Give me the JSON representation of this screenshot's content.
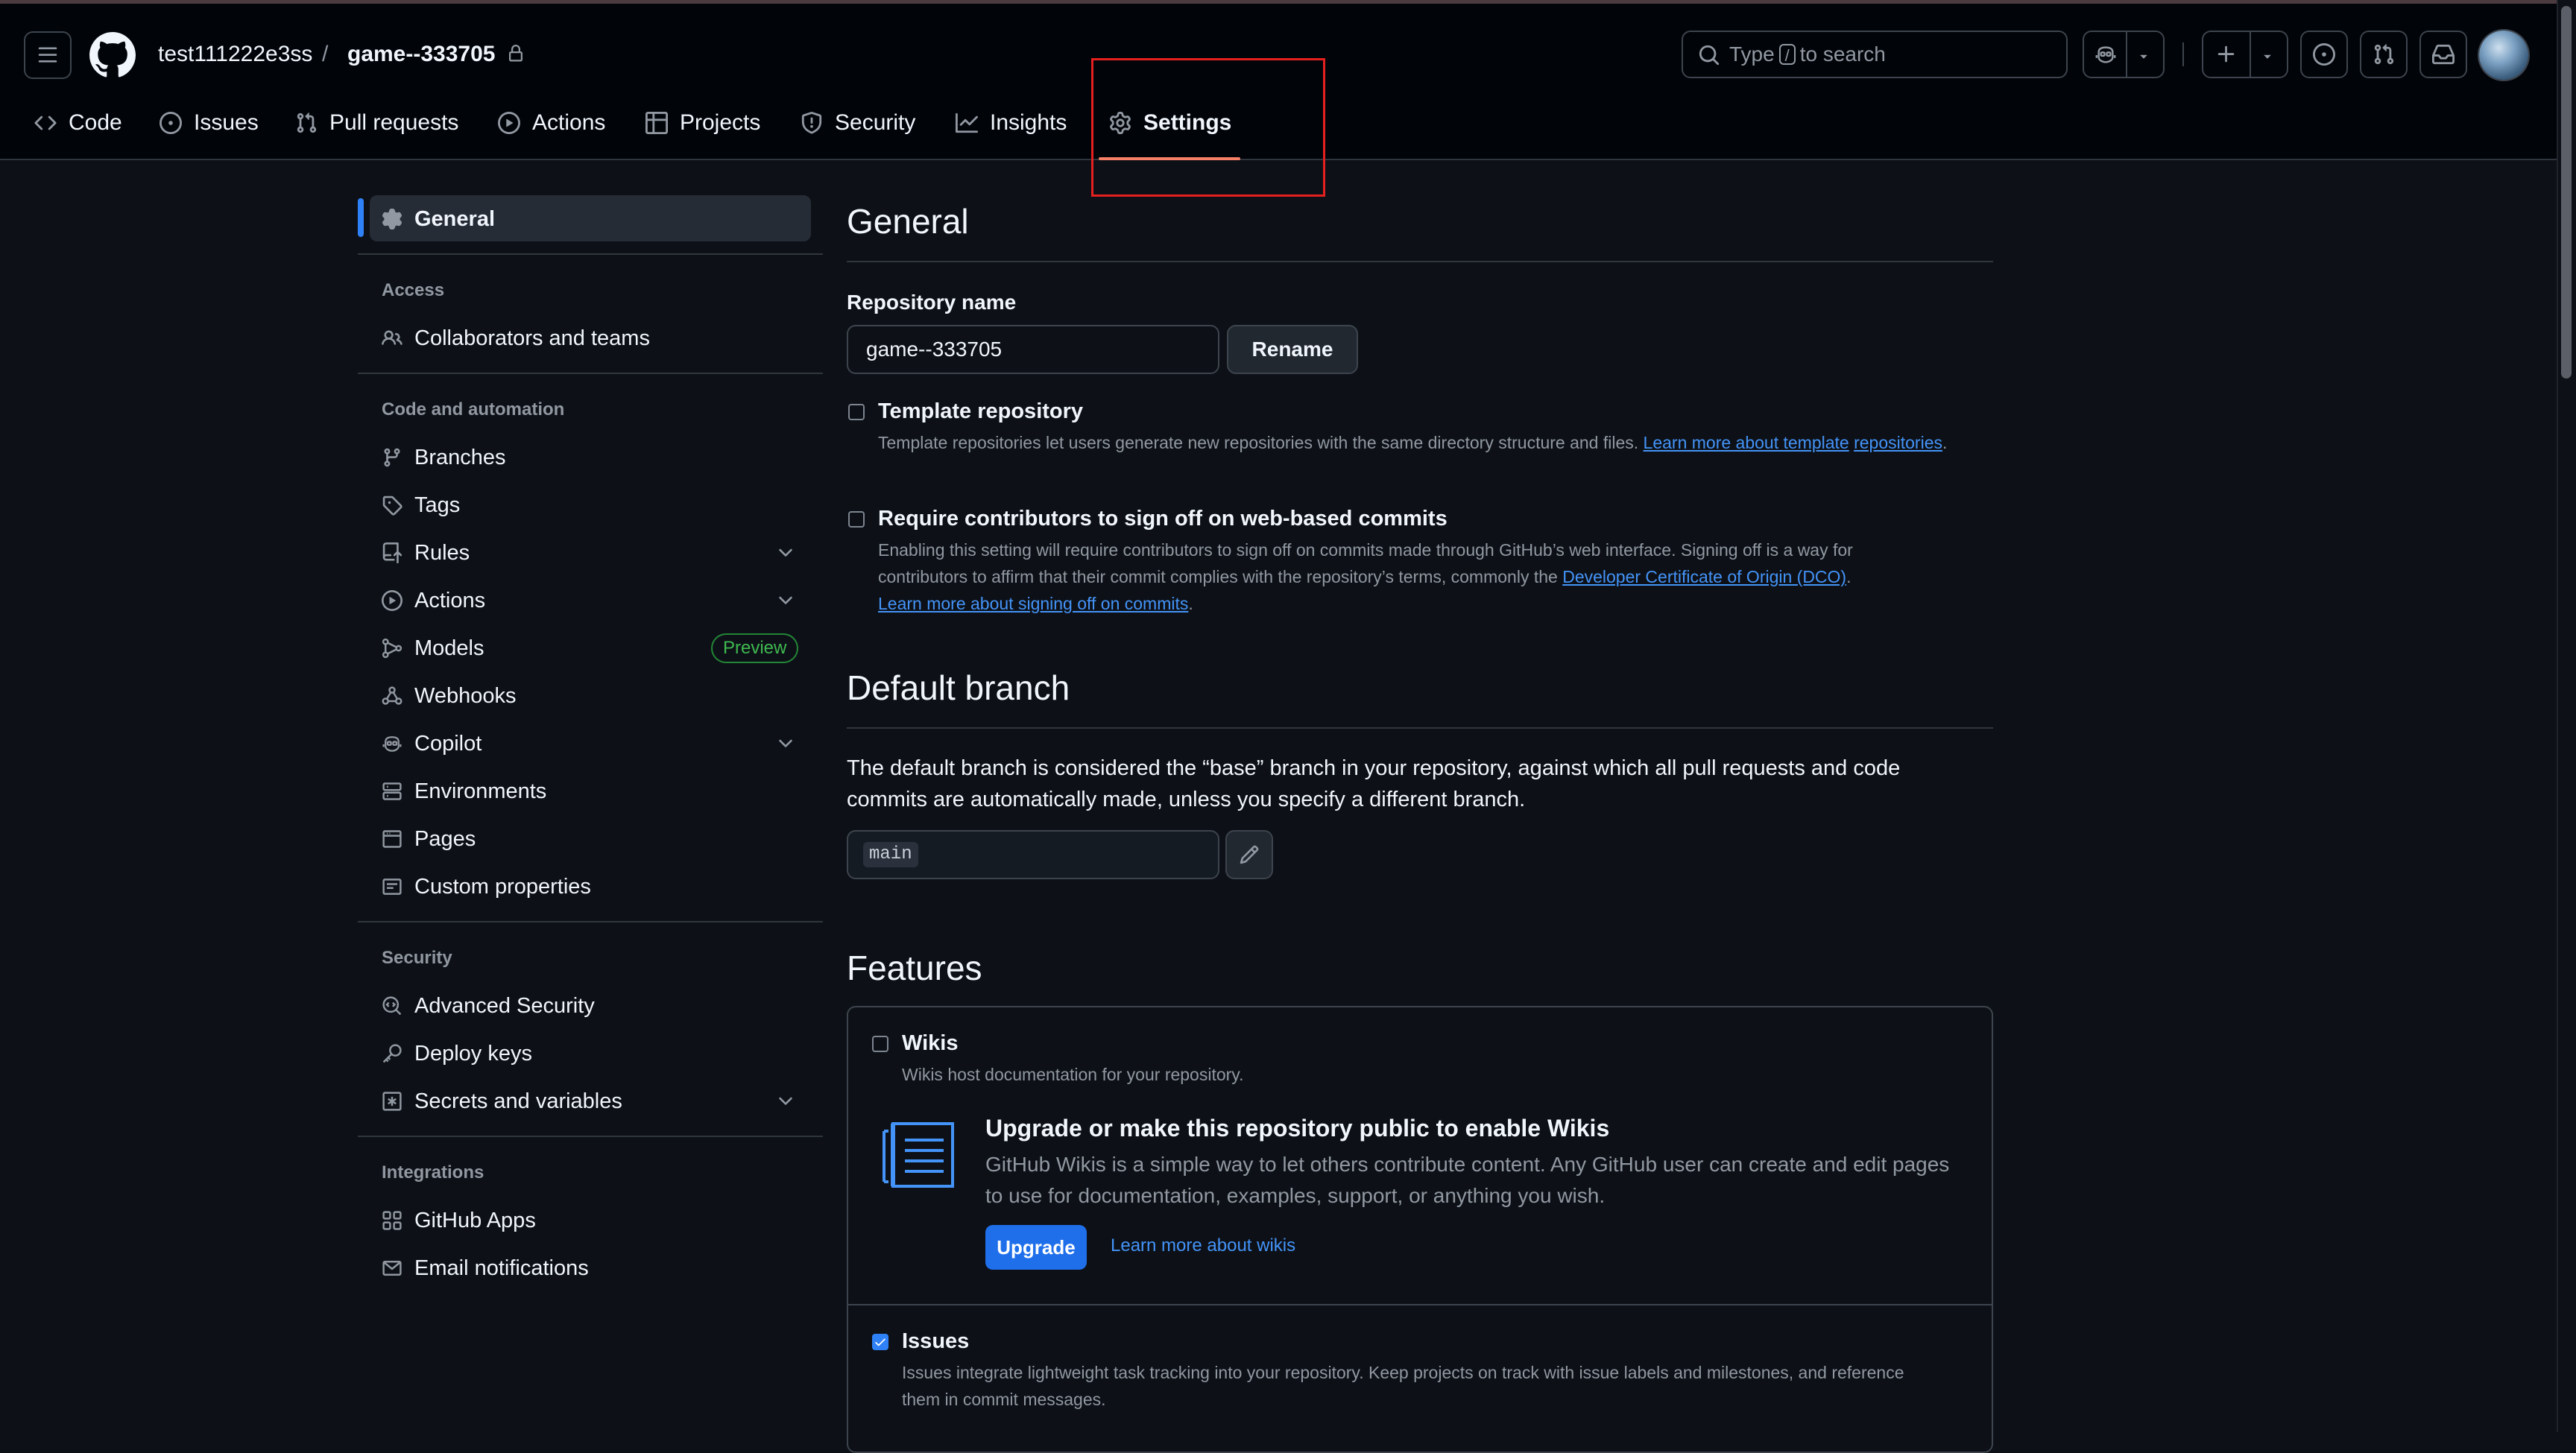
{
  "header": {
    "owner": "test111222e3ss",
    "separator": "/",
    "repo": "game--333705",
    "search_prefix": "Type",
    "search_key": "/",
    "search_suffix": "to search"
  },
  "repo_tabs": [
    {
      "label": "Code",
      "icon": "code-icon"
    },
    {
      "label": "Issues",
      "icon": "issue-opened-icon"
    },
    {
      "label": "Pull requests",
      "icon": "pull-request-icon"
    },
    {
      "label": "Actions",
      "icon": "play-icon"
    },
    {
      "label": "Projects",
      "icon": "table-icon"
    },
    {
      "label": "Security",
      "icon": "shield-icon"
    },
    {
      "label": "Insights",
      "icon": "graph-icon"
    },
    {
      "label": "Settings",
      "icon": "gear-icon",
      "selected": true
    }
  ],
  "sidebar": {
    "general": "General",
    "sections": {
      "access": "Access",
      "code_automation": "Code and automation",
      "security": "Security",
      "integrations": "Integrations"
    },
    "items": {
      "collaborators": "Collaborators and teams",
      "branches": "Branches",
      "tags": "Tags",
      "rules": "Rules",
      "actions": "Actions",
      "models": "Models",
      "models_badge": "Preview",
      "webhooks": "Webhooks",
      "copilot": "Copilot",
      "environments": "Environments",
      "pages": "Pages",
      "custom_properties": "Custom properties",
      "advanced_security": "Advanced Security",
      "deploy_keys": "Deploy keys",
      "secrets": "Secrets and variables",
      "github_apps": "GitHub Apps",
      "email_notifications": "Email notifications"
    }
  },
  "general": {
    "heading": "General",
    "repo_name_label": "Repository name",
    "repo_name_value": "game--333705",
    "rename_label": "Rename",
    "template": {
      "title": "Template repository",
      "checked": false,
      "desc": "Template repositories let users generate new repositories with the same directory structure and files.",
      "link1": "Learn more about template",
      "link2": "repositories",
      "end": "."
    },
    "signoff": {
      "title": "Require contributors to sign off on web-based commits",
      "checked": false,
      "desc1": "Enabling this setting will require contributors to sign off on commits made through GitHub’s web interface. Signing off is a way for",
      "desc2": "contributors to affirm that their commit complies with the repository’s terms, commonly the",
      "link_dco": "Developer Certificate of Origin (DCO)",
      "link_learn": "Learn more about signing off on commits",
      "end": "."
    }
  },
  "default_branch": {
    "heading": "Default branch",
    "desc": "The default branch is considered the “base” branch in your repository, against which all pull requests and code commits are automatically made, unless you specify a different branch.",
    "branch": "main"
  },
  "features": {
    "heading": "Features",
    "wikis": {
      "title": "Wikis",
      "checked": false,
      "desc": "Wikis host documentation for your repository.",
      "upgrade_title": "Upgrade or make this repository public to enable Wikis",
      "upgrade_desc": "GitHub Wikis is a simple way to let others contribute content. Any GitHub user can create and edit pages to use for documentation, examples, support, or anything you wish.",
      "upgrade_button": "Upgrade",
      "learn_more": "Learn more about wikis"
    },
    "issues": {
      "title": "Issues",
      "checked": true,
      "desc": "Issues integrate lightweight task tracking into your repository. Keep projects on track with issue labels and milestones, and reference them in commit messages."
    }
  },
  "colors": {
    "background": "#0d1117",
    "header_bg": "#010409",
    "accent_link": "#4493f8",
    "selected_tab_underline": "#f78166",
    "highlight_box": "#e5201f",
    "upgrade_button": "#1f6feb",
    "preview_badge": "#3fb950"
  }
}
